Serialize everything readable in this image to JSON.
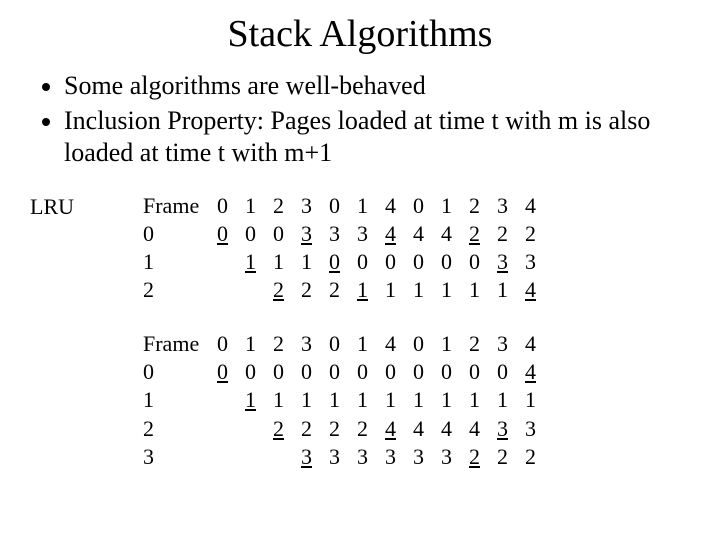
{
  "title": "Stack Algorithms",
  "bullets": [
    "Some algorithms are well-behaved",
    "Inclusion Property: Pages loaded at time t with m is also loaded at time t with m+1"
  ],
  "lru_label": "LRU",
  "tableA": {
    "header_label": "Frame",
    "header": [
      "0",
      "1",
      "2",
      "3",
      "0",
      "1",
      "4",
      "0",
      "1",
      "2",
      "3",
      "4"
    ],
    "rows": [
      {
        "label": "0",
        "cells": [
          {
            "t": "0",
            "u": true
          },
          {
            "t": "0"
          },
          {
            "t": "0"
          },
          {
            "t": "3",
            "u": true
          },
          {
            "t": "3"
          },
          {
            "t": "3"
          },
          {
            "t": "4",
            "u": true
          },
          {
            "t": "4"
          },
          {
            "t": "4"
          },
          {
            "t": "2",
            "u": true
          },
          {
            "t": "2"
          },
          {
            "t": "2"
          }
        ]
      },
      {
        "label": "1",
        "cells": [
          {
            "t": ""
          },
          {
            "t": "1",
            "u": true
          },
          {
            "t": "1"
          },
          {
            "t": "1"
          },
          {
            "t": "0",
            "u": true
          },
          {
            "t": "0"
          },
          {
            "t": "0"
          },
          {
            "t": "0"
          },
          {
            "t": "0"
          },
          {
            "t": "0"
          },
          {
            "t": "3",
            "u": true
          },
          {
            "t": "3"
          }
        ]
      },
      {
        "label": "2",
        "cells": [
          {
            "t": ""
          },
          {
            "t": ""
          },
          {
            "t": "2",
            "u": true
          },
          {
            "t": "2"
          },
          {
            "t": "2"
          },
          {
            "t": "1",
            "u": true
          },
          {
            "t": "1"
          },
          {
            "t": "1"
          },
          {
            "t": "1"
          },
          {
            "t": "1"
          },
          {
            "t": "1"
          },
          {
            "t": "4",
            "u": true
          }
        ]
      }
    ]
  },
  "tableB": {
    "header_label": "Frame",
    "header": [
      "0",
      "1",
      "2",
      "3",
      "0",
      "1",
      "4",
      "0",
      "1",
      "2",
      "3",
      "4"
    ],
    "rows": [
      {
        "label": "0",
        "cells": [
          {
            "t": "0",
            "u": true
          },
          {
            "t": "0"
          },
          {
            "t": "0"
          },
          {
            "t": "0"
          },
          {
            "t": "0"
          },
          {
            "t": "0"
          },
          {
            "t": "0"
          },
          {
            "t": "0"
          },
          {
            "t": "0"
          },
          {
            "t": "0"
          },
          {
            "t": "0"
          },
          {
            "t": "4",
            "u": true
          }
        ]
      },
      {
        "label": "1",
        "cells": [
          {
            "t": ""
          },
          {
            "t": "1",
            "u": true
          },
          {
            "t": "1"
          },
          {
            "t": "1"
          },
          {
            "t": "1"
          },
          {
            "t": "1"
          },
          {
            "t": "1"
          },
          {
            "t": "1"
          },
          {
            "t": "1"
          },
          {
            "t": "1"
          },
          {
            "t": "1"
          },
          {
            "t": "1"
          }
        ]
      },
      {
        "label": "2",
        "cells": [
          {
            "t": ""
          },
          {
            "t": ""
          },
          {
            "t": "2",
            "u": true
          },
          {
            "t": "2"
          },
          {
            "t": "2"
          },
          {
            "t": "2"
          },
          {
            "t": "4",
            "u": true
          },
          {
            "t": "4"
          },
          {
            "t": "4"
          },
          {
            "t": "4"
          },
          {
            "t": "3",
            "u": true
          },
          {
            "t": "3"
          }
        ]
      },
      {
        "label": "3",
        "cells": [
          {
            "t": ""
          },
          {
            "t": ""
          },
          {
            "t": ""
          },
          {
            "t": "3",
            "u": true
          },
          {
            "t": "3"
          },
          {
            "t": "3"
          },
          {
            "t": "3"
          },
          {
            "t": "3"
          },
          {
            "t": "3"
          },
          {
            "t": "2",
            "u": true
          },
          {
            "t": "2"
          },
          {
            "t": "2"
          }
        ]
      }
    ]
  }
}
